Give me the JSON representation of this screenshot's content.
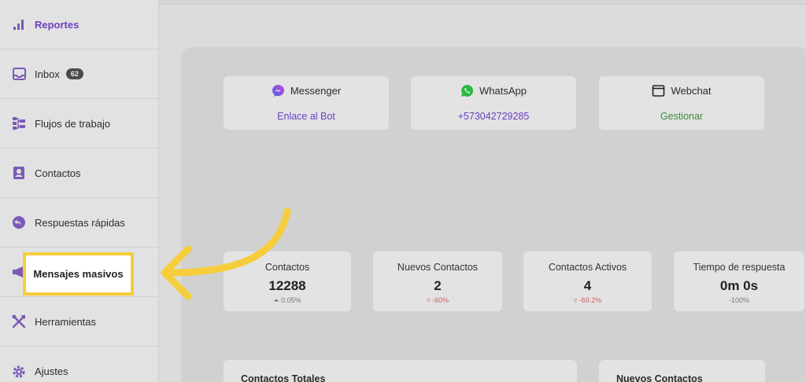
{
  "sidebar": {
    "items": [
      {
        "label": "Reportes",
        "icon": "bar-chart-icon"
      },
      {
        "label": "Inbox",
        "icon": "inbox-icon",
        "badge": "62"
      },
      {
        "label": "Flujos de trabajo",
        "icon": "workflow-icon"
      },
      {
        "label": "Contactos",
        "icon": "contacts-icon"
      },
      {
        "label": "Respuestas rápidas",
        "icon": "quick-reply-icon"
      },
      {
        "label": "Mensajes masivos",
        "icon": "megaphone-icon"
      },
      {
        "label": "Herramientas",
        "icon": "tools-icon"
      },
      {
        "label": "Ajustes",
        "icon": "gear-icon"
      }
    ],
    "active_index": 0,
    "highlighted_index": 5
  },
  "channels": [
    {
      "name": "Messenger",
      "icon": "messenger-icon",
      "link": "Enlace al Bot",
      "link_color": "#6a3fc0"
    },
    {
      "name": "WhatsApp",
      "icon": "whatsapp-icon",
      "link": "+573042729285",
      "link_color": "#6a3fc0"
    },
    {
      "name": "Webchat",
      "icon": "webchat-icon",
      "link": "Gestionar",
      "link_color": "#3d8a3d"
    }
  ],
  "stats": [
    {
      "title": "Contactos",
      "value": "12288",
      "delta": "0.05%",
      "trend": "up"
    },
    {
      "title": "Nuevos Contactos",
      "value": "2",
      "delta": "-60%",
      "trend": "down"
    },
    {
      "title": "Contactos Activos",
      "value": "4",
      "delta": "-69.2%",
      "trend": "down"
    },
    {
      "title": "Tiempo de respuesta",
      "value": "0m 0s",
      "delta": "-100%",
      "trend": "none"
    }
  ],
  "bottom_cards": [
    {
      "title": "Contactos Totales"
    },
    {
      "title": "Nuevos Contactos"
    }
  ],
  "colors": {
    "accent": "#6f3fbf",
    "highlight": "#f6cd3c",
    "icon": "#7b5ab8"
  }
}
